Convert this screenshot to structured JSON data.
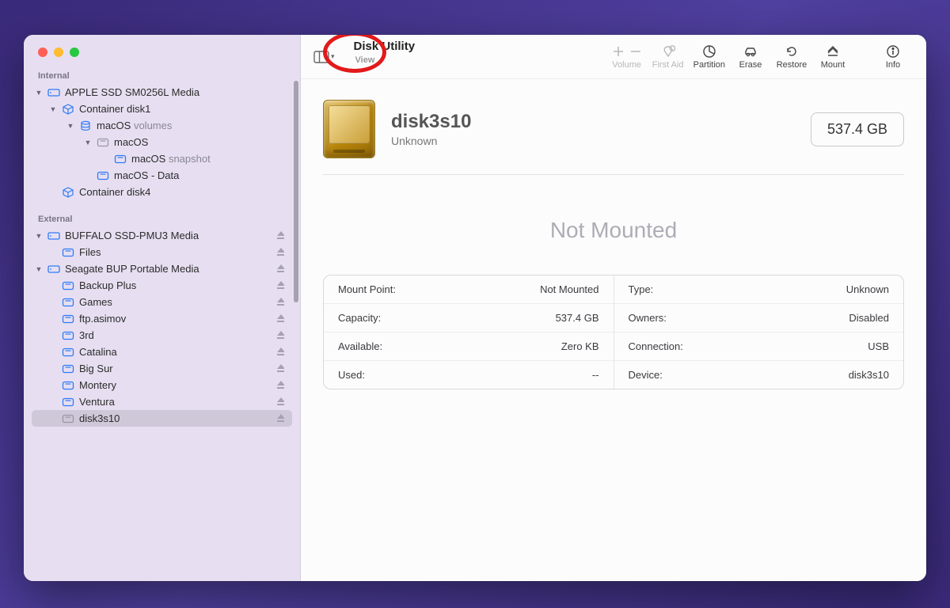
{
  "window": {
    "title": "Disk Utility",
    "title_sub": "View"
  },
  "toolbar": {
    "volume": "Volume",
    "first_aid": "First Aid",
    "partition": "Partition",
    "erase": "Erase",
    "restore": "Restore",
    "mount": "Mount",
    "info": "Info"
  },
  "sidebar": {
    "internal_label": "Internal",
    "external_label": "External",
    "internal": [
      {
        "label": "APPLE SSD SM0256L Media",
        "icon": "hdd",
        "indent": 0,
        "chev": "down"
      },
      {
        "label": "Container disk1",
        "icon": "cube",
        "indent": 1,
        "chev": "down"
      },
      {
        "label": "macOS",
        "suffix": "volumes",
        "icon": "stack",
        "indent": 2,
        "chev": "down"
      },
      {
        "label": "macOS",
        "icon": "vol-grey",
        "indent": 3,
        "chev": "down"
      },
      {
        "label": "macOS",
        "suffix": "snapshot",
        "icon": "vol",
        "indent": 4
      },
      {
        "label": "macOS - Data",
        "icon": "vol",
        "indent": 3
      },
      {
        "label": "Container disk4",
        "icon": "cube",
        "indent": 1
      }
    ],
    "external": [
      {
        "label": "BUFFALO SSD-PMU3 Media",
        "icon": "hdd",
        "indent": 0,
        "chev": "down",
        "eject": true
      },
      {
        "label": "Files",
        "icon": "vol",
        "indent": 1,
        "eject": true
      },
      {
        "label": "Seagate BUP Portable Media",
        "icon": "hdd",
        "indent": 0,
        "chev": "down",
        "eject": true
      },
      {
        "label": "Backup Plus",
        "icon": "vol",
        "indent": 1,
        "eject": true
      },
      {
        "label": "Games",
        "icon": "vol",
        "indent": 1,
        "eject": true
      },
      {
        "label": "ftp.asimov",
        "icon": "vol",
        "indent": 1,
        "eject": true
      },
      {
        "label": "3rd",
        "icon": "vol",
        "indent": 1,
        "eject": true
      },
      {
        "label": "Catalina",
        "icon": "vol",
        "indent": 1,
        "eject": true
      },
      {
        "label": "Big Sur",
        "icon": "vol",
        "indent": 1,
        "eject": true
      },
      {
        "label": "Montery",
        "icon": "vol",
        "indent": 1,
        "eject": true
      },
      {
        "label": "Ventura",
        "icon": "vol",
        "indent": 1,
        "eject": true
      },
      {
        "label": "disk3s10",
        "icon": "vol-grey",
        "indent": 1,
        "eject": true,
        "selected": true
      }
    ]
  },
  "detail": {
    "name": "disk3s10",
    "kind": "Unknown",
    "size": "537.4 GB",
    "status": "Not Mounted",
    "left": [
      {
        "k": "Mount Point:",
        "v": "Not Mounted"
      },
      {
        "k": "Capacity:",
        "v": "537.4 GB"
      },
      {
        "k": "Available:",
        "v": "Zero KB"
      },
      {
        "k": "Used:",
        "v": "--"
      }
    ],
    "right": [
      {
        "k": "Type:",
        "v": "Unknown"
      },
      {
        "k": "Owners:",
        "v": "Disabled"
      },
      {
        "k": "Connection:",
        "v": "USB"
      },
      {
        "k": "Device:",
        "v": "disk3s10"
      }
    ]
  }
}
